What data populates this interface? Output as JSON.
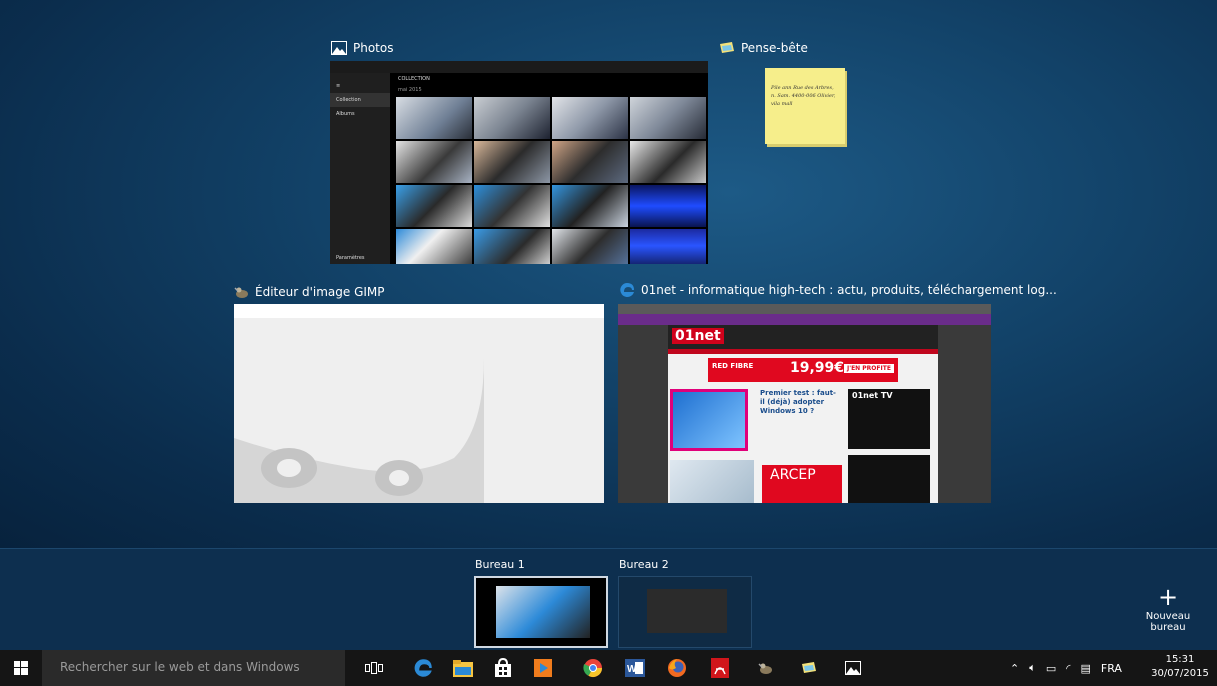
{
  "windows": {
    "photos": {
      "title": "Photos",
      "collection_label": "COLLECTION",
      "month_label": "mai 2015",
      "sidebar": [
        "Collection",
        "Albums"
      ],
      "settings": "Paramètres"
    },
    "sticky": {
      "title": "Pense-bête",
      "note": "Pile ann Rue des Arbres, n. Sam. 4400-006 Olivier, vila mall"
    },
    "gimp": {
      "title": "Éditeur d'image GIMP"
    },
    "edge": {
      "title": "01net - informatique high-tech : actu, produits, téléchargement log...",
      "logo": "01net",
      "article_title": "Premier test : faut-il (déjà) adopter Windows 10 ?",
      "tv_label": "01net TV",
      "ad_text": "RED FIBRE",
      "ad_price": "19,99€",
      "ad_cta": "J'EN PROFITE",
      "arcep": "ARCEP"
    }
  },
  "virtual_desktops": {
    "items": [
      {
        "label": "Bureau 1"
      },
      {
        "label": "Bureau 2"
      }
    ],
    "new_desktop": "Nouveau bureau"
  },
  "taskbar": {
    "search_placeholder": "Rechercher sur le web et dans Windows",
    "language": "FRA",
    "time": "15:31",
    "date": "30/07/2015"
  },
  "colors": {
    "accent": "#2b8ad6",
    "edge_purple": "#6a2c8a",
    "sticky": "#f6ee8b"
  }
}
